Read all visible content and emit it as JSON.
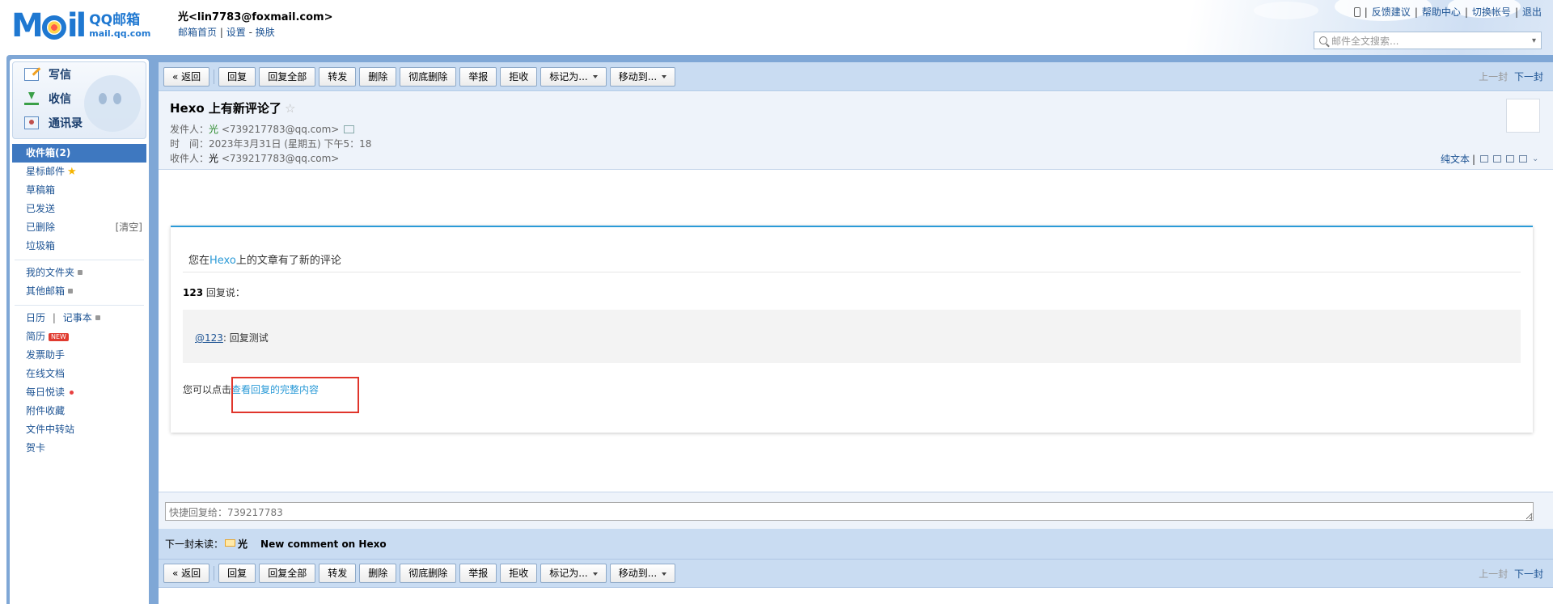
{
  "header": {
    "logo_mail": "MAIL",
    "logo_cn": "QQ邮箱",
    "logo_en": "mail.qq.com",
    "user_display": "光<lin7783@foxmail.com>",
    "link_home": "邮箱首页",
    "link_settings": "设置",
    "link_skin": "换肤",
    "sep_bar": "|",
    "sep_dash": "-",
    "top_links": [
      "反馈建议",
      "帮助中心",
      "切换帐号",
      "退出"
    ],
    "search_placeholder": "邮件全文搜索..."
  },
  "sidebar": {
    "quick": [
      {
        "label": "写信",
        "icon": "compose-icon"
      },
      {
        "label": "收信",
        "icon": "inbox-icon"
      },
      {
        "label": "通讯录",
        "icon": "contacts-icon"
      }
    ],
    "folders": {
      "inbox": "收件箱(2)",
      "starred": "星标邮件",
      "drafts": "草稿箱",
      "sent": "已发送",
      "deleted": "已删除",
      "deleted_action": "[清空]",
      "spam": "垃圾箱",
      "my_folders": "我的文件夹",
      "other_mailbox": "其他邮箱",
      "calendar": "日历",
      "calendar_sep": "|",
      "notes": "记事本",
      "resume": "简历",
      "resume_badge": "NEW",
      "invoice": "发票助手",
      "docs": "在线文档",
      "daily": "每日悦读",
      "attachments": "附件收藏",
      "transfer": "文件中转站",
      "cards": "贺卡"
    }
  },
  "toolbar": {
    "back": "« 返回",
    "reply": "回复",
    "reply_all": "回复全部",
    "forward": "转发",
    "delete": "删除",
    "delete_perm": "彻底删除",
    "report": "举报",
    "reject": "拒收",
    "mark_as": "标记为...",
    "move_to": "移动到...",
    "prev": "上一封",
    "next": "下一封"
  },
  "mail": {
    "subject": "Hexo 上有新评论了",
    "star": "☆",
    "from_label": "发件人：",
    "from_name": "光",
    "from_addr": "<739217783@qq.com>",
    "time_label": "时　间：",
    "time_value": "2023年3月31日 (星期五) 下午5：18",
    "to_label": "收件人：",
    "to_name": "光",
    "to_addr": "<739217783@qq.com>",
    "plain_text": "纯文本",
    "tools_sep": "|"
  },
  "body": {
    "intro_before": "您在",
    "intro_link": "Hexo",
    "intro_after": "上的文章有了新的评论",
    "replier": "123",
    "replied_label": " 回复说：",
    "quote_mention": "@123",
    "quote_text": ": 回复测试",
    "cta_before": "您可以点击",
    "cta_link": "查看回复的完整内容"
  },
  "quick_reply": {
    "placeholder": "快捷回复给：739217783"
  },
  "next_unread": {
    "label": "下一封未读：",
    "sender": "光",
    "subject": "New comment on Hexo"
  },
  "colors": {
    "frame": "#7fa7d6",
    "toolbar": "#c9dcf2",
    "accent": "#2a9ad7",
    "highlight_box": "#e0352b"
  }
}
